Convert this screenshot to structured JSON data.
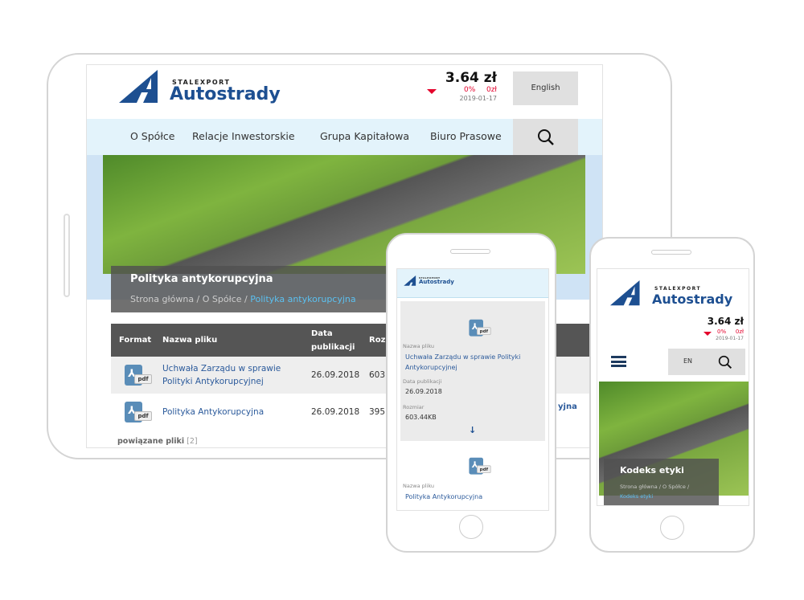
{
  "brand": {
    "top": "STALEXPORT",
    "name": "Autostrady"
  },
  "stock": {
    "price": "3.64 zł",
    "change_pct": "0%",
    "change_abs": "0zł",
    "date": "2019-01-17",
    "trend": "down"
  },
  "colors": {
    "brand": "#1d4f91",
    "nav_bg": "#e3f3fb",
    "table_header": "#555555",
    "link": "#2b5a9b",
    "negative": "#e4002b"
  },
  "tablet": {
    "language_button": "English",
    "nav": [
      "O Spółce",
      "Relacje Inwestorskie",
      "Grupa Kapitałowa",
      "Biuro Prasowe"
    ],
    "page_title": "Polityka antykorupcyjna",
    "breadcrumb": [
      "Strona główna",
      "O Spółce",
      "Polityka antykorupcyjna"
    ],
    "table": {
      "headers": [
        "Format",
        "Nazwa pliku",
        "Data publikacji",
        "Rozm"
      ],
      "rows": [
        {
          "format": "pdf",
          "name": "Uchwała Zarządu w sprawie Polityki Antykorupcyjnej",
          "date": "26.09.2018",
          "size": "603.4"
        },
        {
          "format": "pdf",
          "name": "Polityka Antykorupcyjna",
          "date": "26.09.2018",
          "size": "395.9"
        }
      ]
    },
    "related_label": "powiązane pliki",
    "related_count": "[2]"
  },
  "phone1": {
    "files": [
      {
        "name_label": "Nazwa pliku",
        "name": "Uchwała Zarządu w sprawie Polityki Antykorupcyjnej",
        "date_label": "Data publikacji",
        "date": "26.09.2018",
        "size_label": "Rozmiar",
        "size": "603.44KB"
      },
      {
        "name_label": "Nazwa pliku",
        "name": "Polityka Antykorupcyjna"
      }
    ],
    "partial_text": "yjna"
  },
  "phone2": {
    "language_button": "EN",
    "page_title": "Kodeks etyki",
    "breadcrumb": [
      "Strona główna",
      "O Spółce",
      "Kodeks etyki"
    ]
  }
}
